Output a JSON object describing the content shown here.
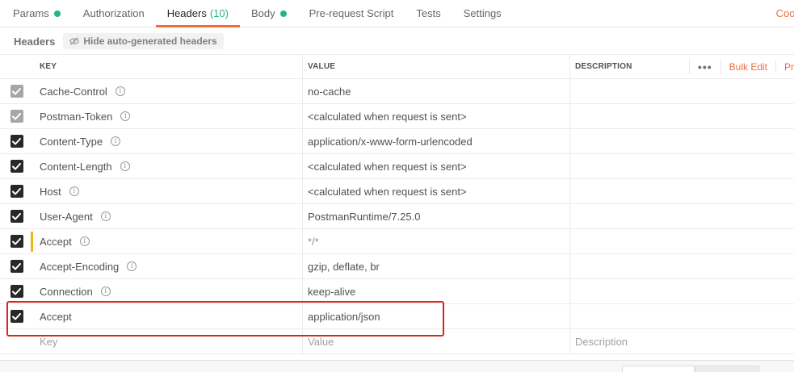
{
  "tabs": [
    {
      "label": "Params",
      "dot": true
    },
    {
      "label": "Authorization",
      "dot": false
    },
    {
      "label": "Headers",
      "count": "(10)",
      "active": true
    },
    {
      "label": "Body",
      "dot": true
    },
    {
      "label": "Pre-request Script",
      "dot": false
    },
    {
      "label": "Tests",
      "dot": false
    },
    {
      "label": "Settings",
      "dot": false
    }
  ],
  "cookies_label": "Cook",
  "subhead": {
    "title": "Headers",
    "hide_button": "Hide auto-generated headers"
  },
  "table": {
    "columns": {
      "key": "KEY",
      "value": "VALUE",
      "description": "DESCRIPTION"
    },
    "actions": {
      "more": "•••",
      "bulk_edit": "Bulk Edit",
      "presets": "Pr"
    },
    "rows": [
      {
        "key": "Cache-Control",
        "value": "no-cache",
        "checked": true,
        "auto": true,
        "info": true
      },
      {
        "key": "Postman-Token",
        "value": "<calculated when request is sent>",
        "checked": true,
        "auto": true,
        "info": true
      },
      {
        "key": "Content-Type",
        "value": "application/x-www-form-urlencoded",
        "checked": true,
        "auto": false,
        "info": true
      },
      {
        "key": "Content-Length",
        "value": "<calculated when request is sent>",
        "checked": true,
        "auto": false,
        "info": true
      },
      {
        "key": "Host",
        "value": "<calculated when request is sent>",
        "checked": true,
        "auto": false,
        "info": true
      },
      {
        "key": "User-Agent",
        "value": "PostmanRuntime/7.25.0",
        "checked": true,
        "auto": false,
        "info": true
      },
      {
        "key": "Accept",
        "value": "*/*",
        "checked": true,
        "auto": false,
        "info": true,
        "overridden": true
      },
      {
        "key": "Accept-Encoding",
        "value": "gzip, deflate, br",
        "checked": true,
        "auto": false,
        "info": true
      },
      {
        "key": "Connection",
        "value": "keep-alive",
        "checked": true,
        "auto": false,
        "info": true
      },
      {
        "key": "Accept",
        "value": "application/json",
        "checked": true,
        "auto": false,
        "info": false,
        "highlighted": true
      }
    ],
    "new_row": {
      "key_placeholder": "Key",
      "value_placeholder": "Value",
      "description_placeholder": "Description"
    }
  },
  "colors": {
    "accent": "#f26b3a",
    "green": "#26b47f",
    "warning": "#f2b317",
    "highlight": "#d9261c"
  }
}
